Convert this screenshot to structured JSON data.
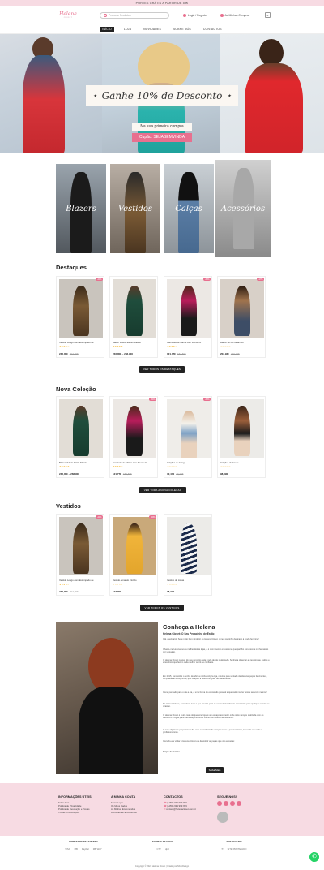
{
  "topbar": {
    "text": "PORTES GRÁTIS A PARTIR DE 59€"
  },
  "header": {
    "logo_text": "Helena",
    "logo_sub": "CLOSET",
    "search_placeholder": "Procurar Produtos",
    "login_label": "Login / Registo",
    "wishlist_label": "As Minhas Compras",
    "cart_count": "0"
  },
  "nav": {
    "items": [
      "INÍCIO",
      "LOJA",
      "NOVIDADES",
      "SOBRE NÓS",
      "CONTACTOS"
    ]
  },
  "hero": {
    "title": "Ganhe 10% de Desconto",
    "line1": "Na sua primeira compra",
    "line2": "Cupão: SEJABEMVINDA"
  },
  "categories": [
    "Blazers",
    "Vestidos",
    "Calças",
    "Acessórios"
  ],
  "sections": {
    "destaques": {
      "title": "Destaques",
      "button": "VER TODOS OS DESTAQUES",
      "products": [
        {
          "name": "Vestido Longo com Estampado de",
          "price": "246,00€",
          "old": "307,00€",
          "badge": "-20%"
        },
        {
          "name": "Blazer Veludo Estilo Alfaiate",
          "price": "246,00€ – 282,90€",
          "old": "",
          "badge": ""
        },
        {
          "name": "Camisola de Malha com Decote A",
          "price": "121,77€",
          "old": "184,50€",
          "badge": "-34%"
        },
        {
          "name": "Blazer de Lã Caramelo",
          "price": "203,93€",
          "old": "246,00€",
          "badge": "-17%"
        }
      ]
    },
    "nova": {
      "title": "Nova Coleção",
      "button": "VER TODA A NOVA COLEÇÃO",
      "products": [
        {
          "name": "Blazer Veludo Estilo Alfaiate",
          "price": "246,00€ – 282,90€",
          "old": "",
          "badge": ""
        },
        {
          "name": "Camisola de Malha com Decote E",
          "price": "121,77€",
          "old": "184,50€",
          "badge": "-34%"
        },
        {
          "name": "Calções de Ganga",
          "price": "32,47€",
          "old": "49,20€",
          "badge": "-34%"
        },
        {
          "name": "Calções de Couro",
          "price": "98,39€",
          "old": "",
          "badge": ""
        }
      ]
    },
    "vestidos": {
      "title": "Vestidos",
      "button": "VER TODOS OS VESTIDOS",
      "products": [
        {
          "name": "Vestido Longo com Estampado de",
          "price": "246,00€",
          "old": "307,00€",
          "badge": "-20%"
        },
        {
          "name": "Vestido Amarelo Florido",
          "price": "123,00€",
          "old": "",
          "badge": "-20%"
        },
        {
          "name": "Vestido de Listas",
          "price": "98,39€",
          "old": "",
          "badge": ""
        }
      ]
    }
  },
  "about": {
    "title": "Conheça a Helena",
    "subtitle": "Helena Closet: O Seu Pedacinho de Estilo",
    "paragraphs": [
      "Olá, querida(o)! Seja muito bem-vinda(o) ao Helena Closet, o meu cantinho dedicado à moda feminina!",
      "Chamo-me Helena, sou a mulher detrás lojas, e é com imenso entusiasmo que partilho convosco a minha paixão por vestuário.",
      "O Helena Closet nasceu do meu encanto pela moda desde muito cedo. Sonhei a observar as tendências, estilos e acessórios que fazem cada mulher sentir-se confiante.",
      "Em 2015, concretizei o sonho de abrir a minha própria loja, movida pela vontade de oferecer peças fascinantes, de qualidade excepcional, que realçam a beleza singular de cada cliente.",
      "Como pensado para o dia a dia, e uma forma de expressão pessoal a que cada mulher possa ser você mesma!",
      "No Helena Closet, encontrará tudo o que precisa para se sentir deslumbrante e confiante para qualquer evento ou ocasião.",
      "O Helena Closet é muito mais do que uma loja, é um espaço acolhedor onde sinto sempre realizada com as clientes e amigas para quem disponibilizo o melhor da moda e atendimento.",
      "O meu objetivo é proporcionar-lhe uma experiência de compra única e personalizada, baseada em estilo e profissionalismo.",
      "Convido-a a visitar o Helena Closet e a descobrir as peças que vão encantar.",
      "Beijos da Helena"
    ],
    "button": "Saiba Mais"
  },
  "footer": {
    "info_title": "INFORMAÇÕES ÚTEIS",
    "info_items": [
      "Sobre Nós",
      "Política de Privacidade",
      "Política de Devolução e Trocas",
      "Trocas e Devoluções"
    ],
    "account_title": "A MINHA CONTA",
    "account_items": [
      "Fazer Login",
      "Os Meus Dados",
      "As Minhas Encomendas",
      "Acompanhar Encomenda"
    ],
    "contact_title": "CONTACTOS",
    "contact_items": [
      "(+351) 999 999 999",
      "(+351) 999 999 999",
      "contact@helenacloset.com.pt"
    ],
    "follow_title": "SEGUE-NOS!"
  },
  "bottom": {
    "payment_title": "FORMAS DE PAGAMENTO",
    "payment_items": [
      "VISA",
      "MB",
      "PayPal",
      "MB WAY"
    ],
    "shipping_title": "FORMAS DE ENVIO",
    "shipping_items": [
      "CTT",
      "dpd"
    ],
    "secure_title": "SITE SEGURO",
    "secure_items": [
      "SITE PROTEGIDO"
    ],
    "copyright": "Copyright © 2024 Helena Closet | Criado por ShopDesign"
  },
  "colors": {
    "accent": "#e8708f",
    "topbar": "#f7dbe3",
    "dark": "#222222"
  }
}
